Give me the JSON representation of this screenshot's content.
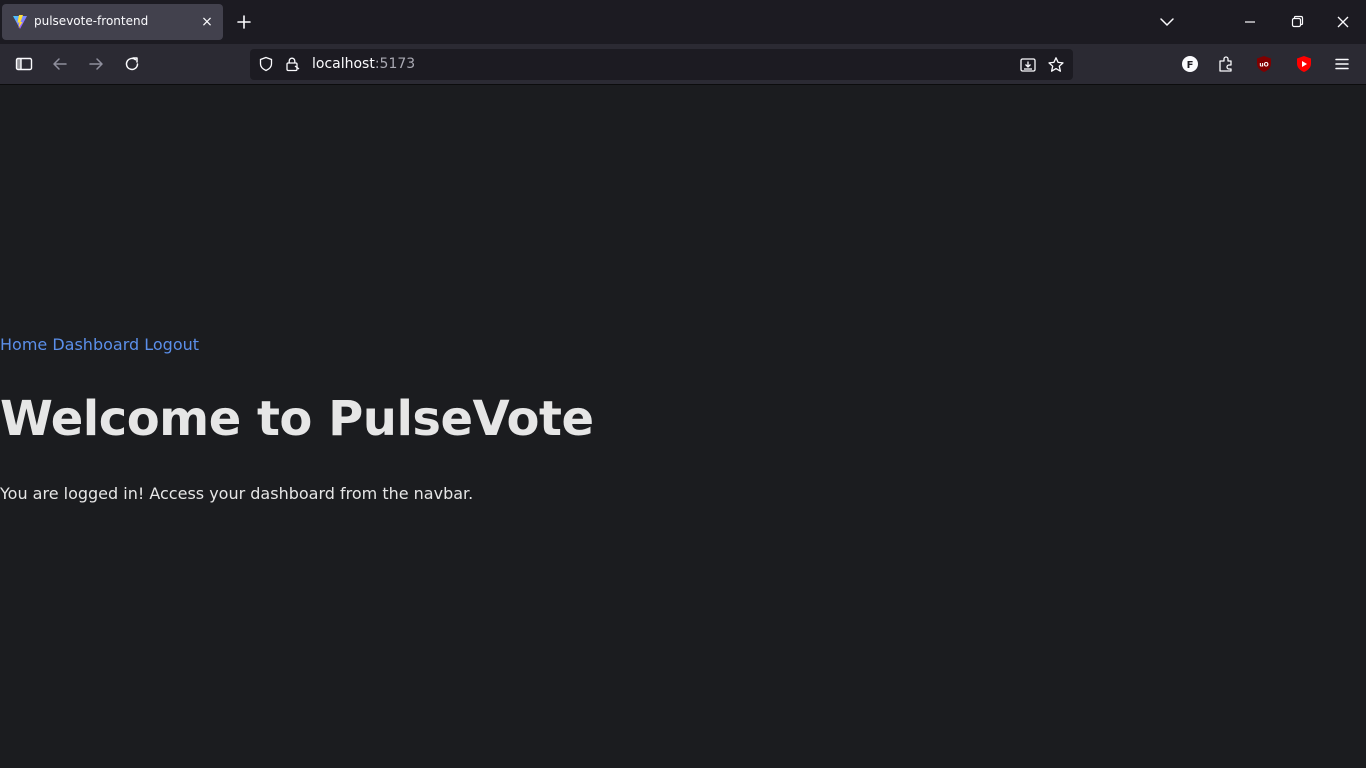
{
  "browser": {
    "tab": {
      "title": "pulsevote-frontend",
      "close_label": "×"
    },
    "url": {
      "host": "localhost",
      "port": ":5173"
    },
    "colors": {
      "tab_bg": "#42414d",
      "chrome_bg": "#2b2a33",
      "urlbar_bg": "#1c1b22",
      "page_bg": "#1b1c1f",
      "link": "#5b8fea"
    }
  },
  "page": {
    "nav": {
      "home": "Home",
      "dashboard": "Dashboard",
      "logout": "Logout"
    },
    "title": "Welcome to PulseVote",
    "message": "You are logged in! Access your dashboard from the navbar."
  }
}
